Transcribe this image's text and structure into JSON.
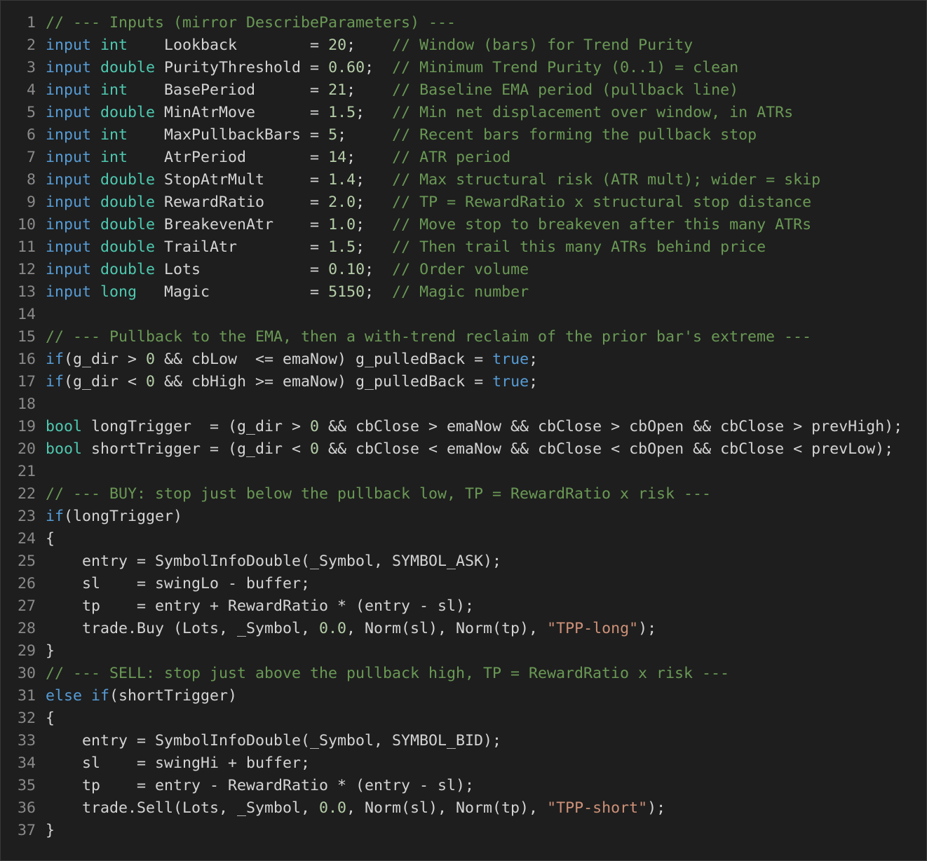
{
  "editor": {
    "language": "MQL5",
    "colors": {
      "background": "#1e1e1e",
      "text": "#d4d4d4",
      "line_number": "#8a8a8a",
      "keyword": "#569cd6",
      "type": "#4ec9b0",
      "comment": "#6a9955",
      "string": "#ce9178",
      "number": "#b5cea8"
    },
    "lines": [
      {
        "n": "1",
        "tokens": [
          [
            "c",
            "// --- Inputs (mirror DescribeParameters) ---"
          ]
        ]
      },
      {
        "n": "2",
        "tokens": [
          [
            "k",
            "input"
          ],
          [
            "p",
            " "
          ],
          [
            "t",
            "int"
          ],
          [
            "p",
            "    Lookback        = "
          ],
          [
            "n",
            "20"
          ],
          [
            "p",
            ";    "
          ],
          [
            "c",
            "// Window (bars) for Trend Purity"
          ]
        ]
      },
      {
        "n": "3",
        "tokens": [
          [
            "k",
            "input"
          ],
          [
            "p",
            " "
          ],
          [
            "t",
            "double"
          ],
          [
            "p",
            " PurityThreshold = "
          ],
          [
            "n",
            "0.60"
          ],
          [
            "p",
            ";  "
          ],
          [
            "c",
            "// Minimum Trend Purity (0..1) = clean"
          ]
        ]
      },
      {
        "n": "4",
        "tokens": [
          [
            "k",
            "input"
          ],
          [
            "p",
            " "
          ],
          [
            "t",
            "int"
          ],
          [
            "p",
            "    BasePeriod      = "
          ],
          [
            "n",
            "21"
          ],
          [
            "p",
            ";    "
          ],
          [
            "c",
            "// Baseline EMA period (pullback line)"
          ]
        ]
      },
      {
        "n": "5",
        "tokens": [
          [
            "k",
            "input"
          ],
          [
            "p",
            " "
          ],
          [
            "t",
            "double"
          ],
          [
            "p",
            " MinAtrMove      = "
          ],
          [
            "n",
            "1.5"
          ],
          [
            "p",
            ";   "
          ],
          [
            "c",
            "// Min net displacement over window, in ATRs"
          ]
        ]
      },
      {
        "n": "6",
        "tokens": [
          [
            "k",
            "input"
          ],
          [
            "p",
            " "
          ],
          [
            "t",
            "int"
          ],
          [
            "p",
            "    MaxPullbackBars = "
          ],
          [
            "n",
            "5"
          ],
          [
            "p",
            ";     "
          ],
          [
            "c",
            "// Recent bars forming the pullback stop"
          ]
        ]
      },
      {
        "n": "7",
        "tokens": [
          [
            "k",
            "input"
          ],
          [
            "p",
            " "
          ],
          [
            "t",
            "int"
          ],
          [
            "p",
            "    AtrPeriod       = "
          ],
          [
            "n",
            "14"
          ],
          [
            "p",
            ";    "
          ],
          [
            "c",
            "// ATR period"
          ]
        ]
      },
      {
        "n": "8",
        "tokens": [
          [
            "k",
            "input"
          ],
          [
            "p",
            " "
          ],
          [
            "t",
            "double"
          ],
          [
            "p",
            " StopAtrMult     = "
          ],
          [
            "n",
            "1.4"
          ],
          [
            "p",
            ";   "
          ],
          [
            "c",
            "// Max structural risk (ATR mult); wider = skip"
          ]
        ]
      },
      {
        "n": "9",
        "tokens": [
          [
            "k",
            "input"
          ],
          [
            "p",
            " "
          ],
          [
            "t",
            "double"
          ],
          [
            "p",
            " RewardRatio     = "
          ],
          [
            "n",
            "2.0"
          ],
          [
            "p",
            ";   "
          ],
          [
            "c",
            "// TP = RewardRatio x structural stop distance"
          ]
        ]
      },
      {
        "n": "10",
        "tokens": [
          [
            "k",
            "input"
          ],
          [
            "p",
            " "
          ],
          [
            "t",
            "double"
          ],
          [
            "p",
            " BreakevenAtr    = "
          ],
          [
            "n",
            "1.0"
          ],
          [
            "p",
            ";   "
          ],
          [
            "c",
            "// Move stop to breakeven after this many ATRs"
          ]
        ]
      },
      {
        "n": "11",
        "tokens": [
          [
            "k",
            "input"
          ],
          [
            "p",
            " "
          ],
          [
            "t",
            "double"
          ],
          [
            "p",
            " TrailAtr        = "
          ],
          [
            "n",
            "1.5"
          ],
          [
            "p",
            ";   "
          ],
          [
            "c",
            "// Then trail this many ATRs behind price"
          ]
        ]
      },
      {
        "n": "12",
        "tokens": [
          [
            "k",
            "input"
          ],
          [
            "p",
            " "
          ],
          [
            "t",
            "double"
          ],
          [
            "p",
            " Lots            = "
          ],
          [
            "n",
            "0.10"
          ],
          [
            "p",
            ";  "
          ],
          [
            "c",
            "// Order volume"
          ]
        ]
      },
      {
        "n": "13",
        "tokens": [
          [
            "k",
            "input"
          ],
          [
            "p",
            " "
          ],
          [
            "t",
            "long"
          ],
          [
            "p",
            "   Magic           = "
          ],
          [
            "n",
            "5150"
          ],
          [
            "p",
            ";  "
          ],
          [
            "c",
            "// Magic number"
          ]
        ]
      },
      {
        "n": "14",
        "tokens": []
      },
      {
        "n": "15",
        "tokens": [
          [
            "c",
            "// --- Pullback to the EMA, then a with-trend reclaim of the prior bar's extreme ---"
          ]
        ]
      },
      {
        "n": "16",
        "tokens": [
          [
            "k",
            "if"
          ],
          [
            "p",
            "(g_dir > "
          ],
          [
            "n",
            "0"
          ],
          [
            "p",
            " && cbLow  <= emaNow) g_pulledBack = "
          ],
          [
            "k",
            "true"
          ],
          [
            "p",
            ";"
          ]
        ]
      },
      {
        "n": "17",
        "tokens": [
          [
            "k",
            "if"
          ],
          [
            "p",
            "(g_dir < "
          ],
          [
            "n",
            "0"
          ],
          [
            "p",
            " && cbHigh >= emaNow) g_pulledBack = "
          ],
          [
            "k",
            "true"
          ],
          [
            "p",
            ";"
          ]
        ]
      },
      {
        "n": "18",
        "tokens": []
      },
      {
        "n": "19",
        "tokens": [
          [
            "t",
            "bool"
          ],
          [
            "p",
            " longTrigger  = (g_dir > "
          ],
          [
            "n",
            "0"
          ],
          [
            "p",
            " && cbClose > emaNow && cbClose > cbOpen && cbClose > prevHigh);"
          ]
        ]
      },
      {
        "n": "20",
        "tokens": [
          [
            "t",
            "bool"
          ],
          [
            "p",
            " shortTrigger = (g_dir < "
          ],
          [
            "n",
            "0"
          ],
          [
            "p",
            " && cbClose < emaNow && cbClose < cbOpen && cbClose < prevLow);"
          ]
        ]
      },
      {
        "n": "21",
        "tokens": []
      },
      {
        "n": "22",
        "tokens": [
          [
            "c",
            "// --- BUY: stop just below the pullback low, TP = RewardRatio x risk ---"
          ]
        ]
      },
      {
        "n": "23",
        "tokens": [
          [
            "k",
            "if"
          ],
          [
            "p",
            "(longTrigger)"
          ]
        ]
      },
      {
        "n": "24",
        "tokens": [
          [
            "p",
            "{"
          ]
        ]
      },
      {
        "n": "25",
        "tokens": [
          [
            "p",
            "    entry = SymbolInfoDouble(_Symbol, SYMBOL_ASK);"
          ]
        ]
      },
      {
        "n": "26",
        "tokens": [
          [
            "p",
            "    sl    = swingLo - buffer;"
          ]
        ]
      },
      {
        "n": "27",
        "tokens": [
          [
            "p",
            "    tp    = entry + RewardRatio * (entry - sl);"
          ]
        ]
      },
      {
        "n": "28",
        "tokens": [
          [
            "p",
            "    trade.Buy (Lots, _Symbol, "
          ],
          [
            "n",
            "0.0"
          ],
          [
            "p",
            ", Norm(sl), Norm(tp), "
          ],
          [
            "s",
            "\"TPP-long\""
          ],
          [
            "p",
            ");"
          ]
        ]
      },
      {
        "n": "29",
        "tokens": [
          [
            "p",
            "}"
          ]
        ]
      },
      {
        "n": "30",
        "tokens": [
          [
            "c",
            "// --- SELL: stop just above the pullback high, TP = RewardRatio x risk ---"
          ]
        ]
      },
      {
        "n": "31",
        "tokens": [
          [
            "k",
            "else"
          ],
          [
            "p",
            " "
          ],
          [
            "k",
            "if"
          ],
          [
            "p",
            "(shortTrigger)"
          ]
        ]
      },
      {
        "n": "32",
        "tokens": [
          [
            "p",
            "{"
          ]
        ]
      },
      {
        "n": "33",
        "tokens": [
          [
            "p",
            "    entry = SymbolInfoDouble(_Symbol, SYMBOL_BID);"
          ]
        ]
      },
      {
        "n": "34",
        "tokens": [
          [
            "p",
            "    sl    = swingHi + buffer;"
          ]
        ]
      },
      {
        "n": "35",
        "tokens": [
          [
            "p",
            "    tp    = entry - RewardRatio * (entry - sl);"
          ]
        ]
      },
      {
        "n": "36",
        "tokens": [
          [
            "p",
            "    trade.Sell(Lots, _Symbol, "
          ],
          [
            "n",
            "0.0"
          ],
          [
            "p",
            ", Norm(sl), Norm(tp), "
          ],
          [
            "s",
            "\"TPP-short\""
          ],
          [
            "p",
            ");"
          ]
        ]
      },
      {
        "n": "37",
        "tokens": [
          [
            "p",
            "}"
          ]
        ]
      }
    ]
  }
}
